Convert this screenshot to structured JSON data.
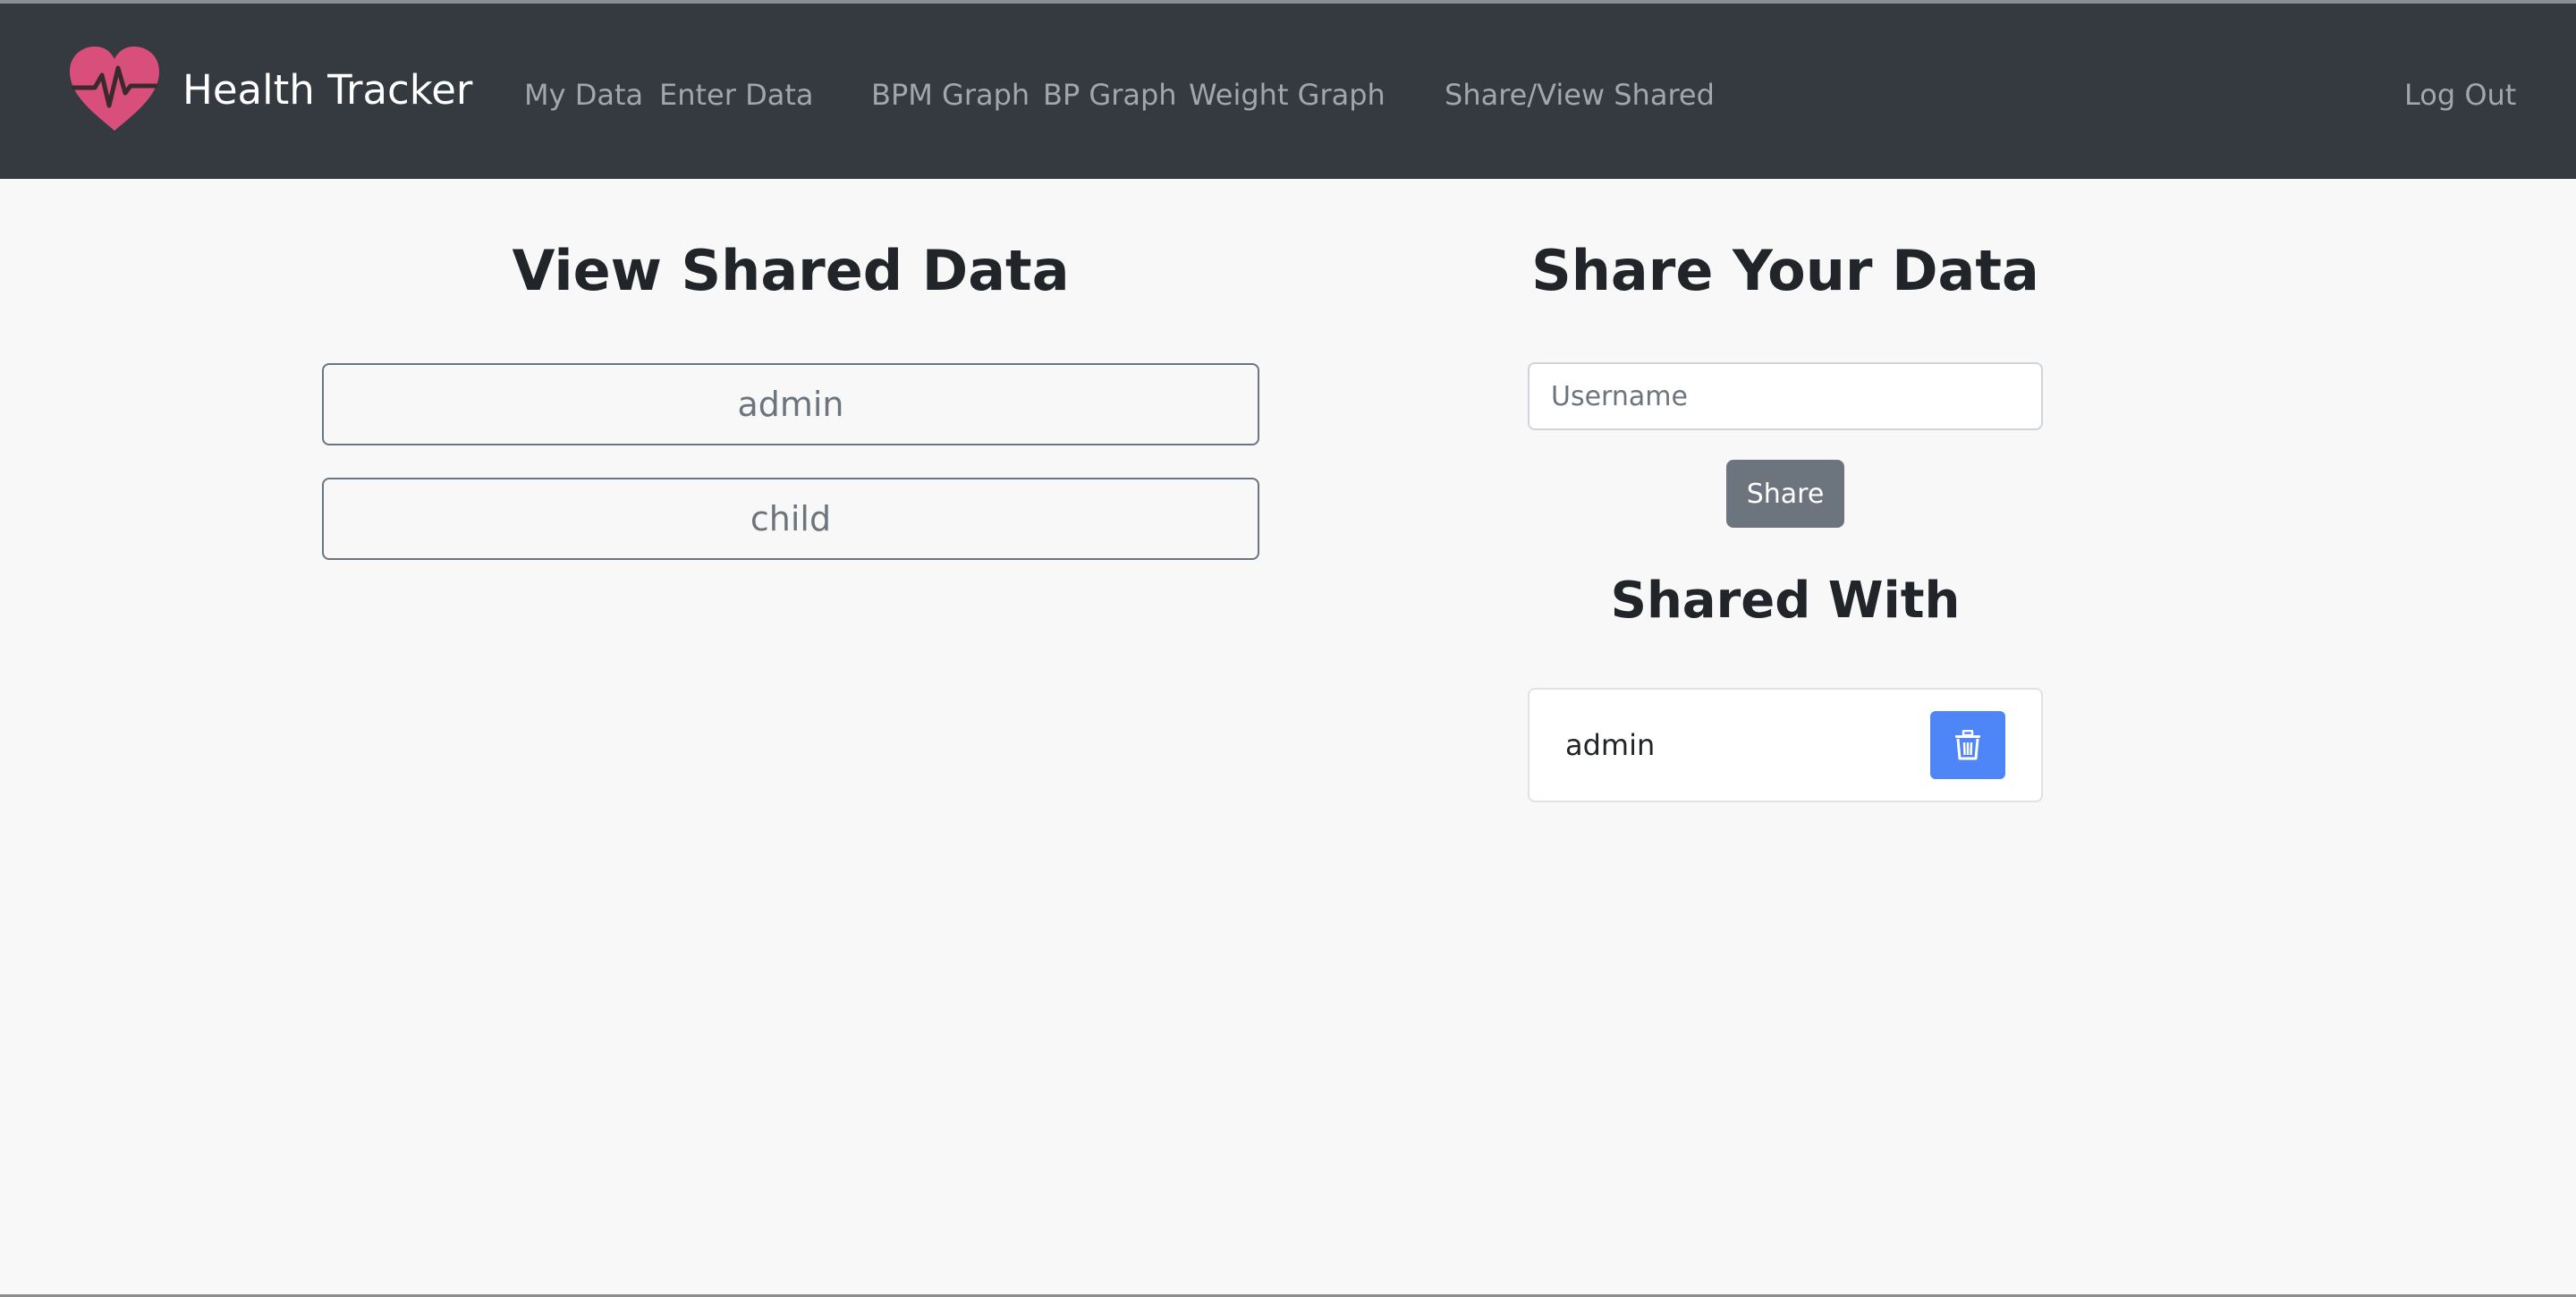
{
  "app": {
    "title": "Health Tracker",
    "logo_icon": "heart-pulse-icon",
    "brand_color": "#d94f7c"
  },
  "nav": {
    "links": [
      {
        "label": "My Data"
      },
      {
        "label": "Enter Data"
      },
      {
        "label": "BPM Graph"
      },
      {
        "label": "BP Graph"
      },
      {
        "label": "Weight Graph"
      },
      {
        "label": "Share/View Shared"
      }
    ],
    "logout_label": "Log Out"
  },
  "view_shared": {
    "heading": "View Shared Data",
    "users": [
      "admin",
      "child"
    ]
  },
  "share_data": {
    "heading": "Share Your Data",
    "username_placeholder": "Username",
    "username_value": "",
    "share_label": "Share"
  },
  "shared_with": {
    "heading": "Shared With",
    "users": [
      {
        "name": "admin",
        "delete_icon": "trash-icon"
      }
    ]
  },
  "colors": {
    "navbar_bg": "#343a40",
    "page_bg": "#f8f8f8",
    "secondary": "#6c757d",
    "primary": "#4f86f7"
  }
}
